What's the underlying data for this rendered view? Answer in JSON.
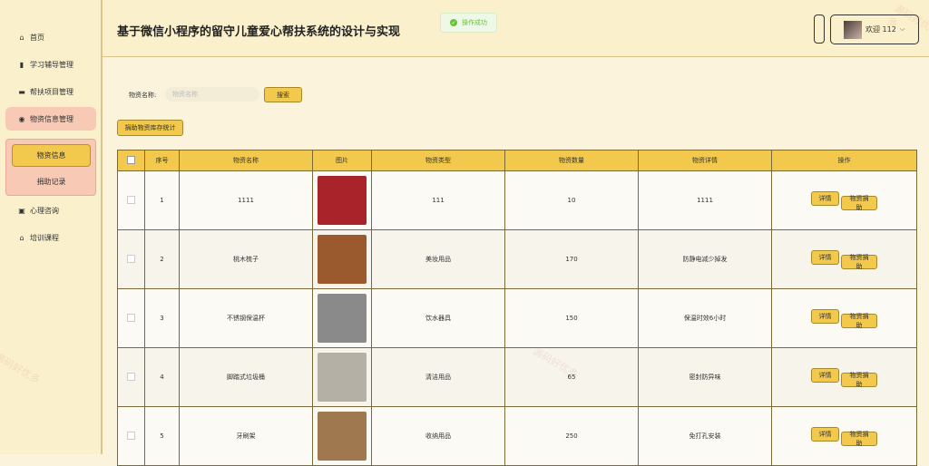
{
  "sidebar": {
    "items": [
      {
        "label": "首页",
        "icon": "home-icon"
      },
      {
        "label": "学习辅导管理",
        "icon": "chart-icon"
      },
      {
        "label": "帮扶项目管理",
        "icon": "card-icon"
      },
      {
        "label": "物资信息管理",
        "icon": "radio-icon"
      },
      {
        "label": "心理咨询",
        "icon": "badge-icon"
      },
      {
        "label": "培训课程",
        "icon": "bank-icon"
      }
    ],
    "submenu": [
      "物资信息",
      "捐助记录"
    ]
  },
  "header": {
    "title": "基于微信小程序的留守儿童爱心帮扶系统的设计与实现",
    "toast": "操作成功",
    "user": "欢迎 112"
  },
  "search": {
    "label": "物资名称:",
    "placeholder": "物资名称",
    "button": "搜索"
  },
  "stat_button": "捐助物资库存统计",
  "table": {
    "headers": [
      "序号",
      "物资名称",
      "图片",
      "物资类型",
      "物资数量",
      "物资详情",
      "操作"
    ],
    "rows": [
      {
        "no": "1",
        "name": "1111",
        "type": "111",
        "qty": "10",
        "detail": "1111",
        "thumb": "#a8242a"
      },
      {
        "no": "2",
        "name": "桃木梳子",
        "type": "美妆用品",
        "qty": "170",
        "detail": "防静电减少掉发",
        "thumb": "#9a5a2e"
      },
      {
        "no": "3",
        "name": "不锈钢保温杯",
        "type": "饮水器具",
        "qty": "150",
        "detail": "保温时效6小时",
        "thumb": "#8a8a8a"
      },
      {
        "no": "4",
        "name": "脚踏式垃圾桶",
        "type": "清洁用品",
        "qty": "65",
        "detail": "密封防异味",
        "thumb": "#b5b0a6"
      },
      {
        "no": "5",
        "name": "牙刷架",
        "type": "收纳用品",
        "qty": "250",
        "detail": "免打孔安装",
        "thumb": "#a07850"
      }
    ],
    "actions": {
      "detail": "详情",
      "donate": "物资捐助"
    }
  },
  "watermark": "源码好优多"
}
